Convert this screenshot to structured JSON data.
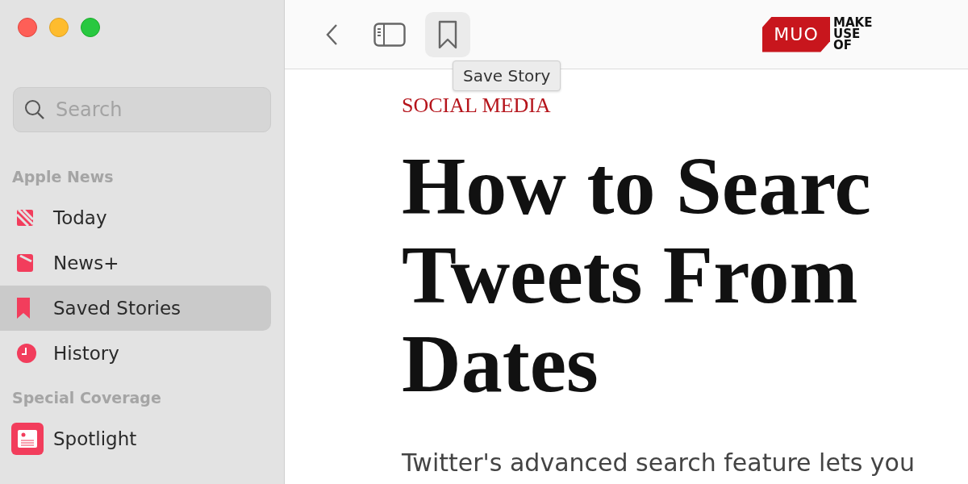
{
  "sidebar": {
    "search": {
      "placeholder": "Search"
    },
    "sections": [
      {
        "title": "Apple News",
        "items": [
          {
            "label": "Today",
            "selected": false
          },
          {
            "label": "News+",
            "selected": false
          },
          {
            "label": "Saved Stories",
            "selected": true
          },
          {
            "label": "History",
            "selected": false
          }
        ]
      },
      {
        "title": "Special Coverage",
        "items": [
          {
            "label": "Spotlight",
            "selected": false
          }
        ]
      }
    ]
  },
  "toolbar": {
    "tooltip": "Save Story",
    "logo": {
      "badge": "MUO",
      "lines": [
        "MAKE",
        "USE",
        "OF"
      ]
    }
  },
  "article": {
    "category": "SOCIAL MEDIA",
    "title_lines": [
      "How to Searc",
      "Tweets From",
      "Dates"
    ],
    "body": "Twitter's advanced search feature lets you"
  }
}
